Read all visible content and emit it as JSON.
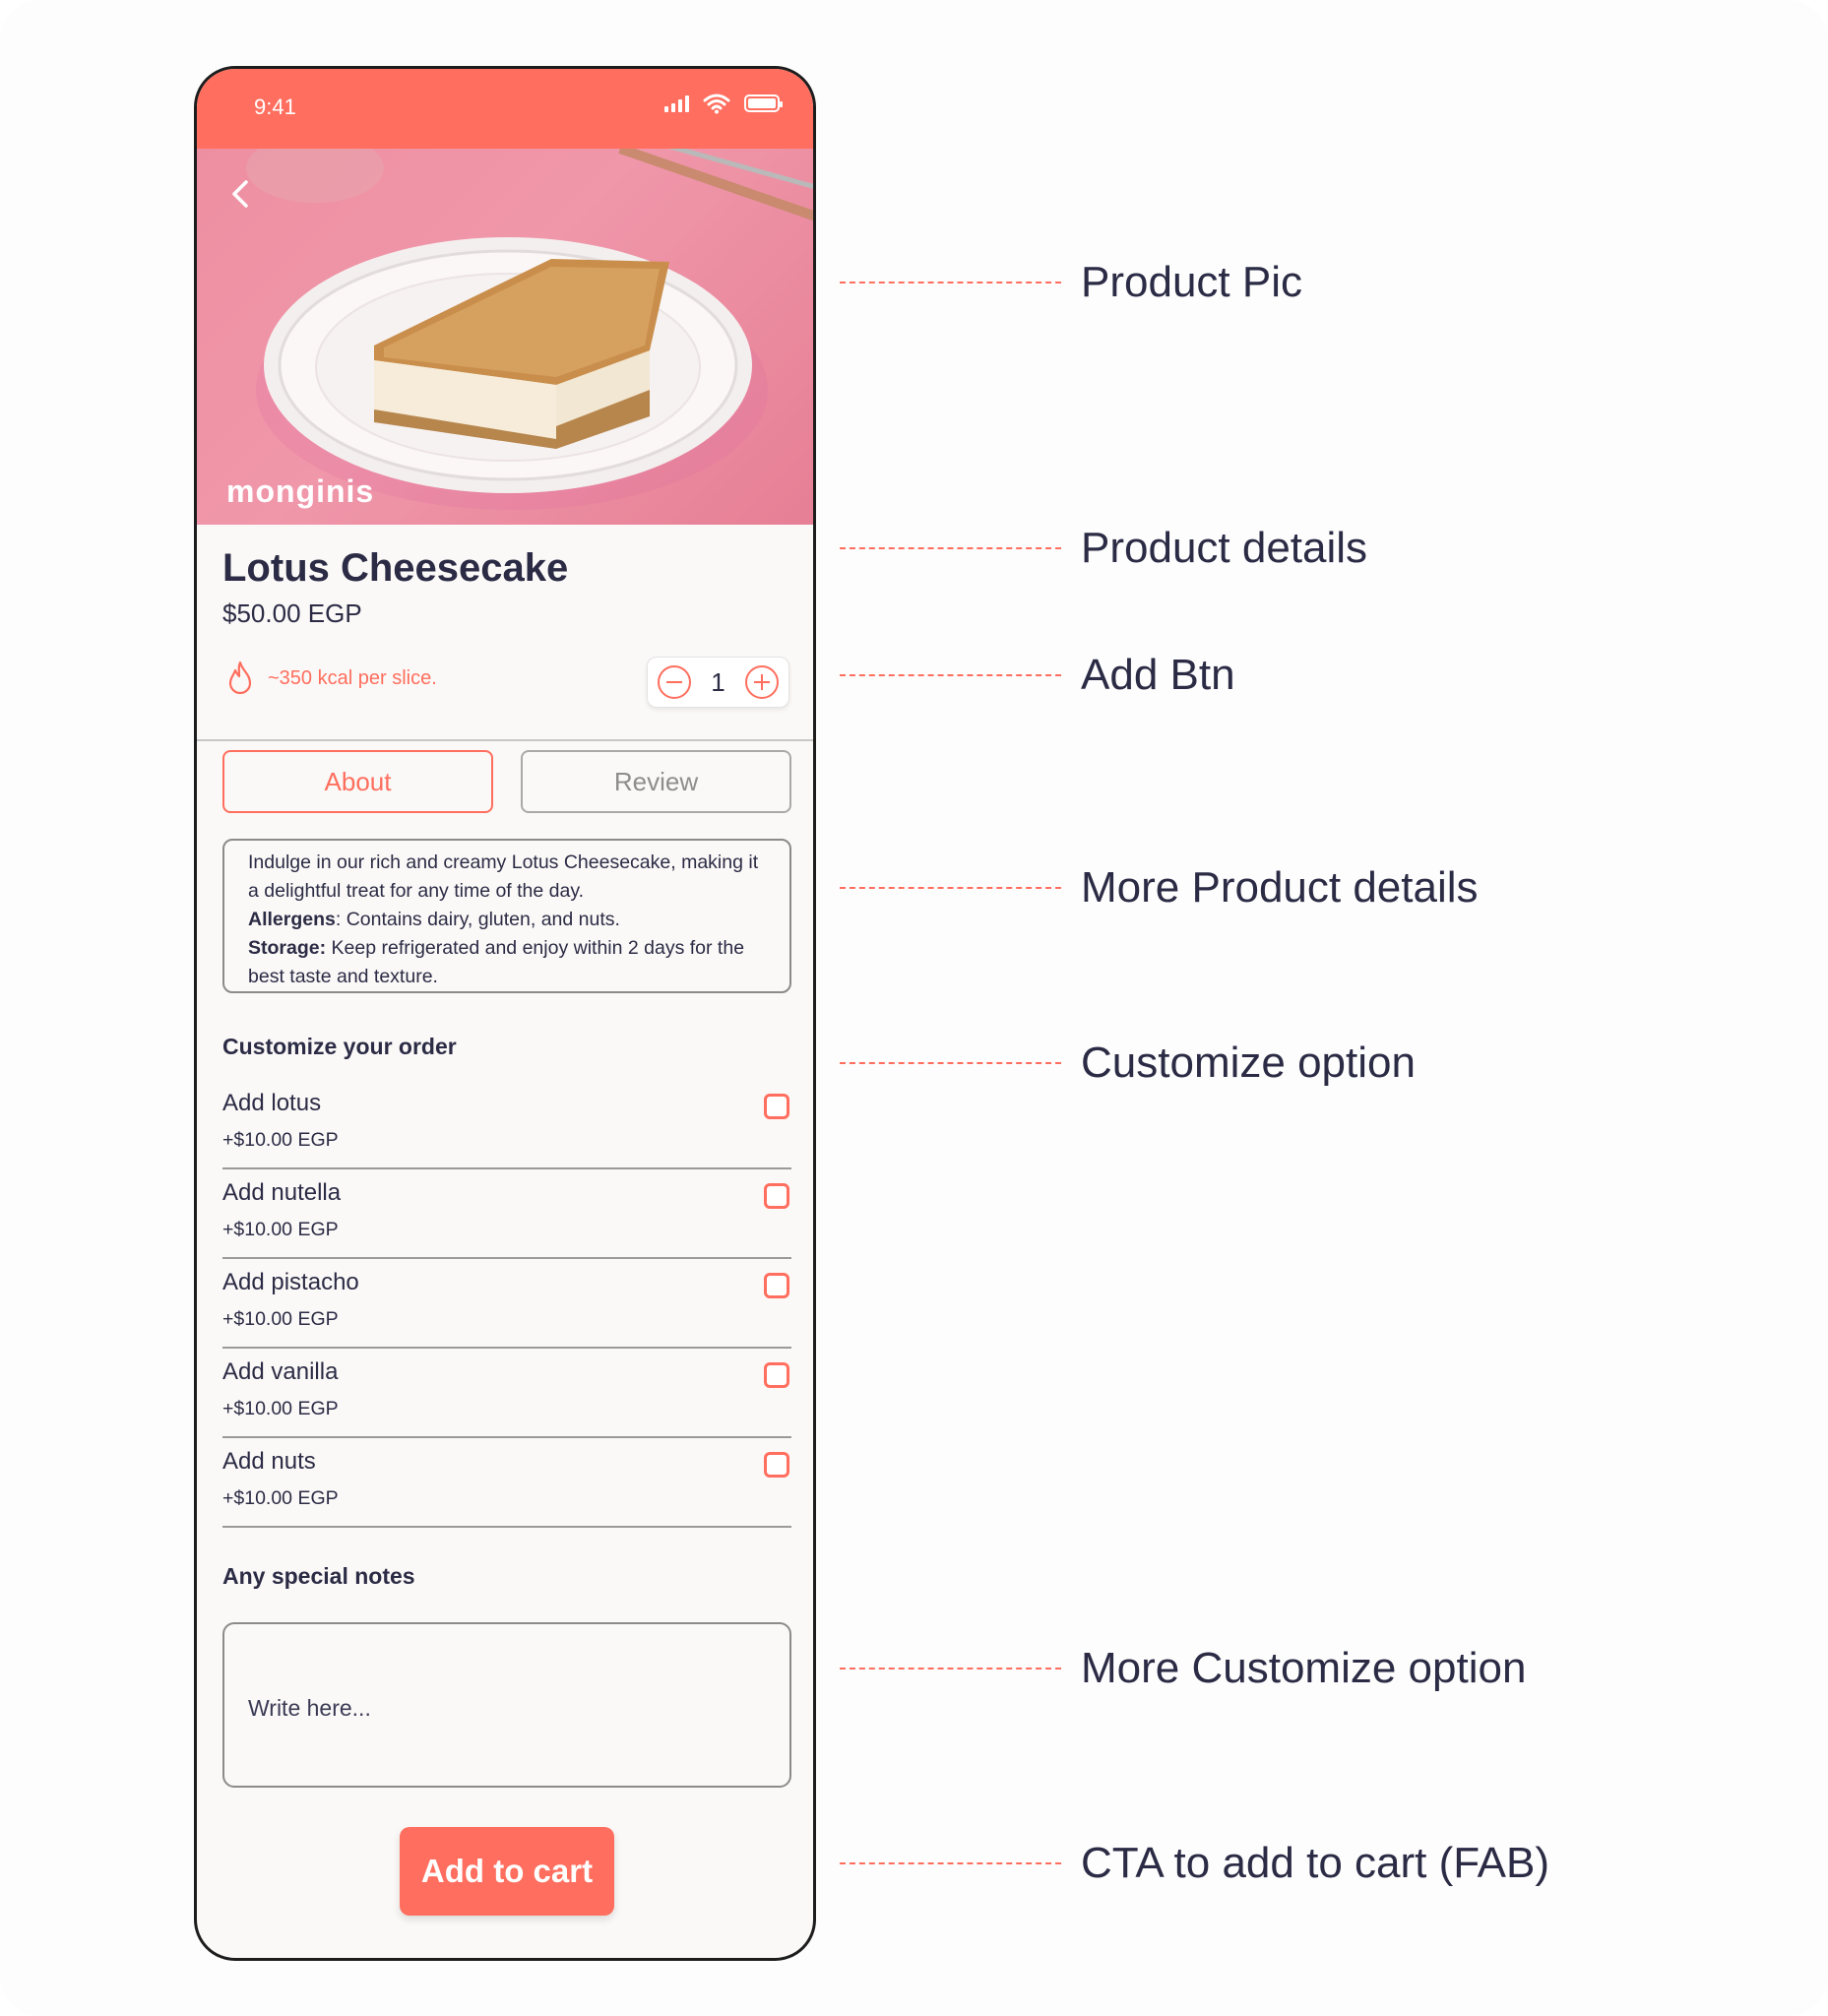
{
  "status_bar": {
    "time": "9:41"
  },
  "hero": {
    "brand": "monginis"
  },
  "product": {
    "title": "Lotus Cheesecake",
    "price": "$50.00 EGP",
    "kcal": "~350 kcal per slice.",
    "quantity": "1"
  },
  "tabs": [
    {
      "label": "About",
      "active": true
    },
    {
      "label": "Review",
      "active": false
    }
  ],
  "about": {
    "description": "Indulge in our rich and creamy Lotus Cheesecake, making it a delightful treat for any time of the day.",
    "allergens_label": "Allergens",
    "allergens_text": ": Contains dairy, gluten, and nuts.",
    "storage_label": "Storage:",
    "storage_text": " Keep refrigerated and enjoy within 2 days for the best taste and texture."
  },
  "customize": {
    "title": "Customize your order",
    "options": [
      {
        "name": "Add lotus",
        "price": "+$10.00 EGP",
        "checked": false
      },
      {
        "name": "Add nutella",
        "price": "+$10.00 EGP",
        "checked": false
      },
      {
        "name": "Add pistacho",
        "price": "+$10.00 EGP",
        "checked": false
      },
      {
        "name": "Add vanilla",
        "price": "+$10.00 EGP",
        "checked": false
      },
      {
        "name": "Add nuts",
        "price": "+$10.00 EGP",
        "checked": false
      }
    ]
  },
  "notes": {
    "title": "Any special notes",
    "placeholder": "Write here..."
  },
  "cta": {
    "label": "Add to cart"
  },
  "annotations": [
    "Product Pic",
    "Product details",
    "Add Btn",
    "More Product details",
    "Customize option",
    "More Customize option",
    "CTA to add to cart (FAB)"
  ],
  "colors": {
    "accent": "#ff6e5e",
    "text": "#2b2b45",
    "hero_bg": "#ee8fa1"
  }
}
